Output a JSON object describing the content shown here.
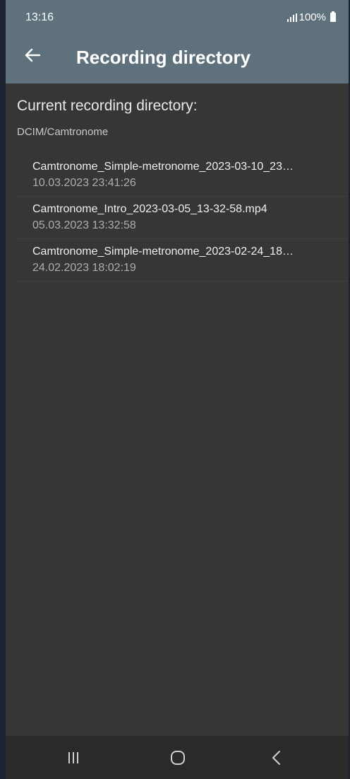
{
  "status_bar": {
    "time": "13:16",
    "battery": "100%",
    "icons": [
      "signal-icon",
      "battery-icon"
    ]
  },
  "app_bar": {
    "title": "Recording directory",
    "back_icon": "back-arrow-icon"
  },
  "content": {
    "section_title": "Current recording directory:",
    "directory": "DCIM/Camtronome",
    "files": [
      {
        "name": "Camtronome_Simple-metronome_2023-03-10_23…",
        "date": "10.03.2023 23:41:26"
      },
      {
        "name": "Camtronome_Intro_2023-03-05_13-32-58.mp4",
        "date": "05.03.2023 13:32:58"
      },
      {
        "name": "Camtronome_Simple-metronome_2023-02-24_18…",
        "date": "24.02.2023 18:02:19"
      }
    ]
  },
  "nav_bar": {
    "icons": [
      "recent-apps-icon",
      "home-icon",
      "back-nav-icon"
    ]
  },
  "colors": {
    "app_bar": "#5e717d",
    "background": "#363636",
    "nav_bar": "#2a2a2a"
  }
}
